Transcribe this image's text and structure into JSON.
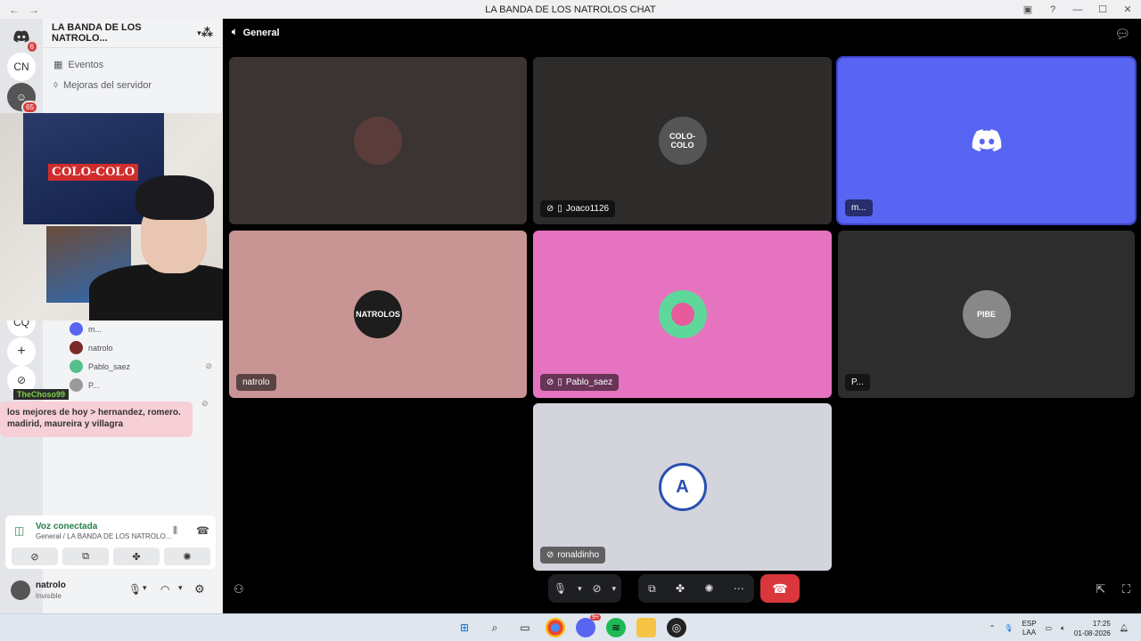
{
  "window": {
    "title": "LA BANDA DE LOS NATROLOS CHAT",
    "back": "←",
    "forward": "→"
  },
  "rail": {
    "servers": [
      {
        "name": "discord-home",
        "glyph": "◉",
        "badge": "6"
      },
      {
        "name": "server-cn",
        "glyph": "CN"
      },
      {
        "name": "server-avatar",
        "glyph": "☺",
        "badge": "65"
      }
    ],
    "extra": [
      "CQ",
      "+",
      "⊘"
    ]
  },
  "sidebar": {
    "server_name": "LA BANDA DE LOS NATROLO...",
    "items": [
      {
        "label": "Eventos",
        "icon": "calendar-icon"
      },
      {
        "label": "Mejoras del servidor",
        "icon": "boost-icon"
      }
    ],
    "voice_users": [
      {
        "name": "m...",
        "color": "#5865f2"
      },
      {
        "name": "natrolo",
        "color": "#7a2a2a"
      },
      {
        "name": "Pablo_saez",
        "color": "#57c08a",
        "muted": true
      },
      {
        "name": "P...",
        "color": "#9a9a9a"
      }
    ]
  },
  "chat_overlay": {
    "author": "TheChoso99",
    "message": "los mejores de hoy > hernandez, romero. madirid, maureira y villagra"
  },
  "voice_panel": {
    "status": "Voz conectada",
    "channel": "General / LA BANDA DE LOS NATROLO..."
  },
  "user_panel": {
    "name": "natrolo",
    "status": "Invisible"
  },
  "stage": {
    "channel": "General",
    "tiles": [
      {
        "name": "",
        "bg": "#3b3432",
        "avatar_text": ""
      },
      {
        "name": "Joaco1126",
        "bg": "#2e2b2b",
        "avatar_text": "COLO-COLO",
        "muted": true,
        "mobile": true
      },
      {
        "name": "m...",
        "bg": "#5865f2",
        "avatar_text": "discord"
      },
      {
        "name": "natrolo",
        "bg": "#c89594",
        "avatar_text": "NATROLOS"
      },
      {
        "name": "Pablo_saez",
        "bg": "#e673c0",
        "avatar_text": "",
        "muted": true,
        "mobile": true
      },
      {
        "name": "P...",
        "bg": "#2d2d2d",
        "avatar_text": "PIBE"
      },
      {
        "name": "ronaldinho",
        "bg": "#d4d4dc",
        "avatar_text": "A",
        "muted": true
      }
    ]
  },
  "taskbar": {
    "lang_top": "ESP",
    "lang_bottom": "LAA",
    "time": "17:25",
    "date": "01-08-2026",
    "discord_badge": "9+"
  },
  "colors": {
    "accent": "#5865f2",
    "hangup": "#da373c",
    "connected": "#248046"
  }
}
